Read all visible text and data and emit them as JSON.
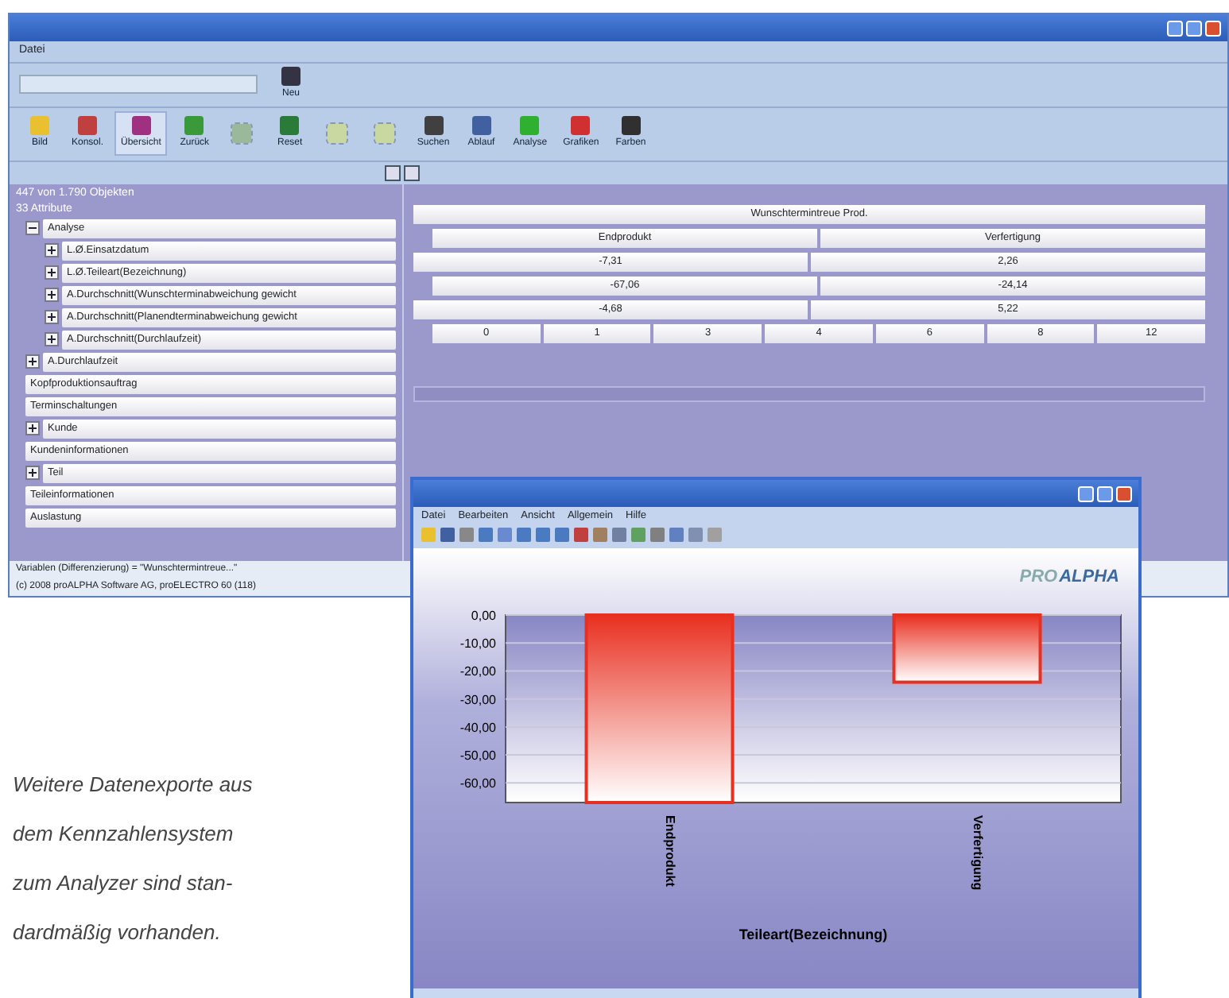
{
  "main_window": {
    "menu": [
      "Datei"
    ],
    "top_toolbar": [
      {
        "label": "Neu",
        "disabled": false
      }
    ],
    "toolbar": [
      {
        "label": "Bild",
        "selected": false,
        "disabled": false,
        "color": "#e8c030"
      },
      {
        "label": "Konsol.",
        "selected": false,
        "disabled": false,
        "color": "#c04040"
      },
      {
        "label": "Übersicht",
        "selected": true,
        "disabled": false,
        "color": "#a03080"
      },
      {
        "label": "Zurück",
        "selected": false,
        "disabled": false,
        "color": "#3a9a3a"
      },
      {
        "selected": false,
        "disabled": true,
        "color": "#9ab89a"
      },
      {
        "label": "Reset",
        "selected": false,
        "disabled": false,
        "color": "#2a7a3a"
      },
      {
        "selected": false,
        "disabled": true,
        "color": "#c8d8a0"
      },
      {
        "selected": false,
        "disabled": true,
        "color": "#c8d8a0"
      },
      {
        "label": "Suchen",
        "selected": false,
        "disabled": false,
        "color": "#404040"
      },
      {
        "label": "Ablauf",
        "selected": false,
        "disabled": false,
        "color": "#4060a0"
      },
      {
        "label": "Analyse",
        "selected": false,
        "disabled": false,
        "color": "#30b030"
      },
      {
        "label": "Grafiken",
        "selected": false,
        "disabled": false,
        "color": "#d03030"
      },
      {
        "label": "Farben",
        "selected": false,
        "disabled": false,
        "color": "#303030"
      }
    ],
    "summary": [
      "447 von 1.790 Objekten",
      "33 Attribute"
    ],
    "tree": [
      {
        "label": "Analyse",
        "expanded": true,
        "children": [
          {
            "label": "L.Ø.Einsatzdatum",
            "expanded": false
          },
          {
            "label": "L.Ø.Teileart(Bezeichnung)",
            "expanded": false
          },
          {
            "label": "A.Durchschnitt(Wunschterminabweichung gewicht",
            "expanded": false
          },
          {
            "label": "A.Durchschnitt(Planendterminabweichung gewicht",
            "expanded": false
          },
          {
            "label": "A.Durchschnitt(Durchlaufzeit)",
            "expanded": false
          }
        ]
      },
      {
        "label": "A.Durchlaufzeit",
        "expanded": false
      },
      {
        "label": "Kopfproduktionsauftrag"
      },
      {
        "label": "Terminschaltungen"
      },
      {
        "label": "Kunde",
        "expanded": false
      },
      {
        "label": "Kundeninformationen"
      },
      {
        "label": "Teil",
        "expanded": false
      },
      {
        "label": "Teileinformationen"
      },
      {
        "label": "Auslastung"
      }
    ],
    "grid_rows": [
      [
        "Wunschtermintreue Prod."
      ],
      [
        "Endprodukt",
        "Verfertigung"
      ],
      [
        "-7,31",
        "2,26"
      ],
      [
        "-67,06",
        "-24,14"
      ],
      [
        "-4,68",
        "5,22"
      ],
      [
        "0",
        "1",
        "3",
        "4",
        "6",
        "8",
        "12"
      ]
    ],
    "status_lines": [
      "Variablen (Differenzierung) = \"Wunschtermintreue...\"",
      "(c) 2008 proALPHA Software AG, proELECTRO 60 (118)"
    ]
  },
  "chart_window": {
    "menu": [
      "Datei",
      "Bearbeiten",
      "Ansicht",
      "Allgemein",
      "Hilfe"
    ],
    "logo": [
      "PRO",
      "ALPHA"
    ],
    "chart_data": {
      "type": "bar",
      "xlabel": "Teileart(Bezeichnung)",
      "categories": [
        "Endprodukt",
        "Verfertigung"
      ],
      "series": [
        {
          "color": "#e83020",
          "values": [
            -67,
            -24
          ]
        }
      ],
      "ylim": [
        -67,
        0
      ],
      "grid": true,
      "yticks": [
        {
          "value": 0,
          "label": "0,00"
        },
        {
          "value": -10,
          "label": "-10,00"
        },
        {
          "value": -20,
          "label": "-20,00"
        },
        {
          "value": -30,
          "label": "-30,00"
        },
        {
          "value": -40,
          "label": "-40,00"
        },
        {
          "value": -50,
          "label": "-50,00"
        },
        {
          "value": -60,
          "label": "-60,00"
        }
      ]
    }
  },
  "caption": [
    "Weitere Datenexporte aus",
    "dem Kennzahlensystem",
    "zum Analyzer sind stan-",
    "dardmäßig vorhanden."
  ]
}
